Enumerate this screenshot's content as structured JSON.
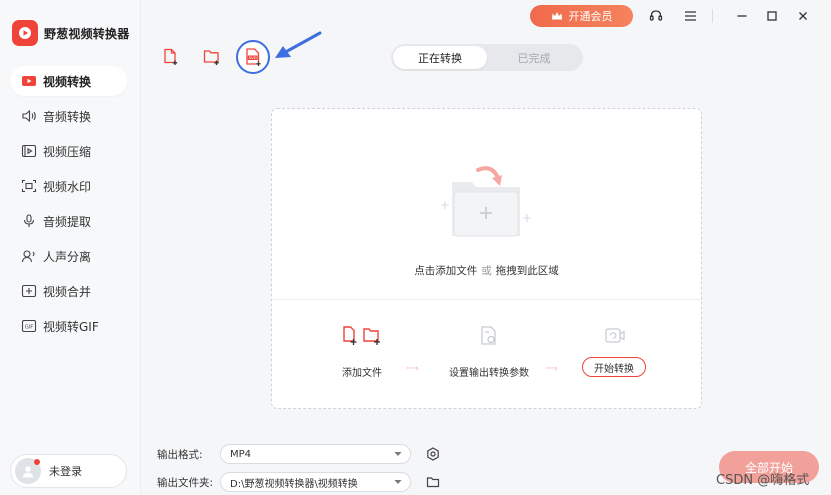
{
  "app": {
    "name": "野葱视频转换器"
  },
  "sidebar": {
    "items": [
      {
        "label": "视频转换",
        "icon": "video-convert-icon",
        "active": true
      },
      {
        "label": "音频转换",
        "icon": "speaker-icon",
        "active": false
      },
      {
        "label": "视频压缩",
        "icon": "compress-icon",
        "active": false
      },
      {
        "label": "视频水印",
        "icon": "watermark-icon",
        "active": false
      },
      {
        "label": "音频提取",
        "icon": "microphone-icon",
        "active": false
      },
      {
        "label": "人声分离",
        "icon": "voice-separate-icon",
        "active": false
      },
      {
        "label": "视频合并",
        "icon": "merge-icon",
        "active": false
      },
      {
        "label": "视频转GIF",
        "icon": "gif-icon",
        "active": false
      }
    ],
    "login_label": "未登录"
  },
  "topbar": {
    "vip_label": "开通会员"
  },
  "tabs": [
    {
      "label": "正在转换",
      "active": true
    },
    {
      "label": "已完成",
      "active": false
    }
  ],
  "dropzone": {
    "hint_add": "点击添加文件",
    "hint_or": "或",
    "hint_drag": "拖拽到此区域",
    "steps": {
      "add_files": "添加文件",
      "set_params": "设置输出转换参数",
      "start": "开始转换"
    }
  },
  "output": {
    "format_label": "输出格式:",
    "format_value": "MP4",
    "folder_label": "输出文件夹:",
    "folder_value": "D:\\野葱视频转换器\\视频转换"
  },
  "start_all_label": "全部开始",
  "watermark": "CSDN @嗨格式",
  "colors": {
    "accent": "#f0433a",
    "highlight_ring": "#3d6fe0",
    "vip": "#f06a4c"
  }
}
